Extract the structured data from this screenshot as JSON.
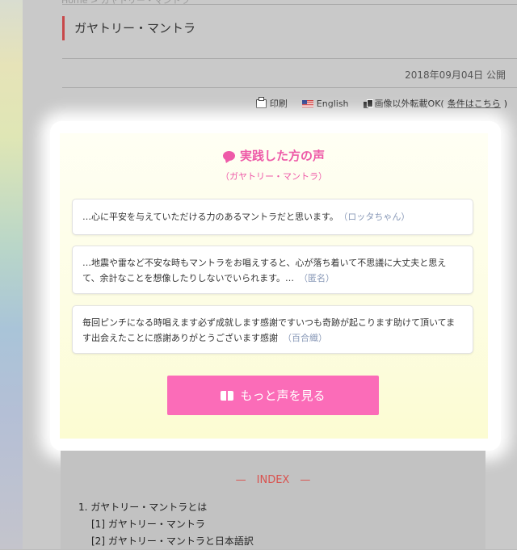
{
  "breadcrumb": "Home > ガヤトリー・マントラ",
  "article": {
    "title": "ガヤトリー・マントラ",
    "date": "2018年09月04日 公開"
  },
  "toolbar": {
    "print": "印刷",
    "english": "English",
    "license_prefix": "画像以外転載OK(",
    "license_link": "条件はこちら",
    "license_suffix": ")"
  },
  "voices": {
    "heading": "実践した方の声",
    "subheading": "（ガヤトリー・マントラ）",
    "items": [
      {
        "text": "…心に平安を与えていただける力のあるマントラだと思います。",
        "author": "（ロッタちゃん）"
      },
      {
        "text": "…地震や雷など不安な時もマントラをお唱えすると、心が落ち着いて不思議に大丈夫と思えて、余計なことを想像したりしないでいられます。…",
        "author": "（匿名）"
      },
      {
        "text": "毎回ピンチになる時唱えます必ず成就します感謝ですいつも奇跡が起こります助けて頂いてます出会えたことに感謝ありがとうございます感謝",
        "author": "（百合織）"
      }
    ],
    "more_button": "もっと声を見る"
  },
  "index": {
    "title": "—　INDEX　—",
    "items": [
      "1. ガヤトリー・マントラとは",
      "[1] ガヤトリー・マントラ",
      "[2] ガヤトリー・マントラと日本語訳"
    ]
  },
  "colors": {
    "accent_pink": "#ee5aa8",
    "button_pink": "#fb6cb8",
    "title_bar_red": "#c8484a",
    "index_red": "#d9524f"
  }
}
